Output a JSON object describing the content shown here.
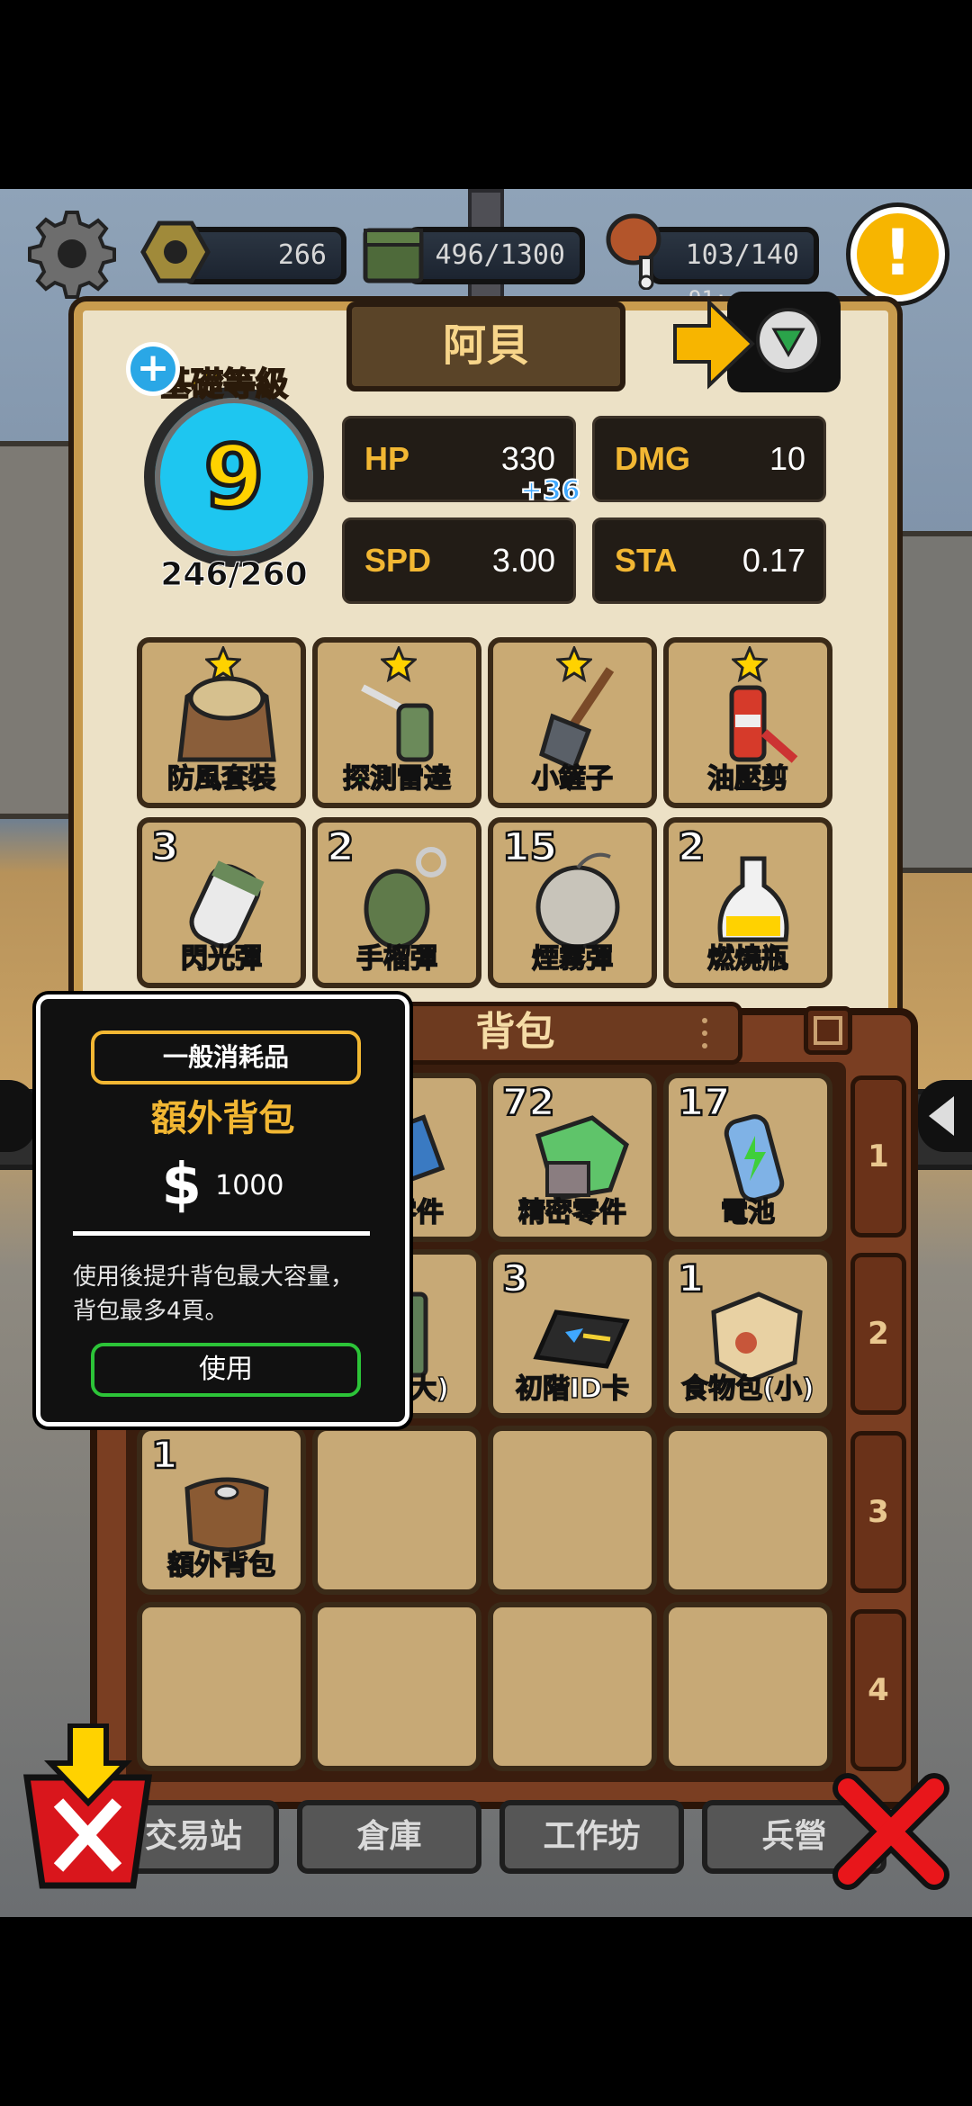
{
  "resources": {
    "bolts": "266",
    "ammo": "496/1300",
    "food": "103/140",
    "food_sub": "91:"
  },
  "character": {
    "name": "阿貝",
    "level_title": "基礎等級",
    "level": "9",
    "exp": "246/260"
  },
  "stats": {
    "hp_label": "HP",
    "hp_value": "330",
    "hp_bonus": "+36",
    "dmg_label": "DMG",
    "dmg_value": "10",
    "spd_label": "SPD",
    "spd_value": "3.00",
    "sta_label": "STA",
    "sta_value": "0.17"
  },
  "equipment": [
    {
      "label": "防風套裝",
      "icon": "armor-icon"
    },
    {
      "label": "探測雷達",
      "icon": "detector-icon"
    },
    {
      "label": "小鏟子",
      "icon": "shovel-icon"
    },
    {
      "label": "油壓剪",
      "icon": "hydraulic-cutter-icon"
    }
  ],
  "consumables": [
    {
      "label": "閃光彈",
      "count": "3",
      "icon": "flashbang-icon"
    },
    {
      "label": "手榴彈",
      "count": "2",
      "icon": "grenade-icon"
    },
    {
      "label": "煙霧彈",
      "count": "15",
      "icon": "smoke-bomb-icon"
    },
    {
      "label": "燃燒瓶",
      "count": "2",
      "icon": "molotov-icon"
    }
  ],
  "backpack": {
    "title": "背包",
    "tabs": [
      "1",
      "2",
      "3",
      "4"
    ],
    "items": [
      {
        "label": "零件",
        "count": "",
        "icon": "parts-icon"
      },
      {
        "label": "精密零件",
        "count": "72",
        "icon": "precision-parts-icon"
      },
      {
        "label": "電池",
        "count": "17",
        "icon": "battery-icon"
      },
      {
        "label": "(大)",
        "count": "",
        "icon": "ammo-box-icon"
      },
      {
        "label": "初階ID卡",
        "count": "3",
        "icon": "id-card-icon"
      },
      {
        "label": "食物包(小)",
        "count": "1",
        "icon": "food-pack-icon"
      },
      {
        "label": "額外背包",
        "count": "1",
        "icon": "extra-bag-icon"
      }
    ]
  },
  "popup": {
    "category": "一般消耗品",
    "name": "額外背包",
    "currency": "$",
    "price": "1000",
    "desc_line1": "使用後提升背包最大容量，",
    "desc_line2": "背包最多4頁。",
    "use_label": "使用"
  },
  "nav": {
    "trade": "交易站",
    "warehouse": "倉庫",
    "workshop": "工作坊",
    "barracks": "兵營"
  },
  "colors": {
    "accent_gold": "#f2b733",
    "level_circle": "#1ec6f0",
    "close_red": "#e8161b",
    "use_green": "#2cc438"
  }
}
